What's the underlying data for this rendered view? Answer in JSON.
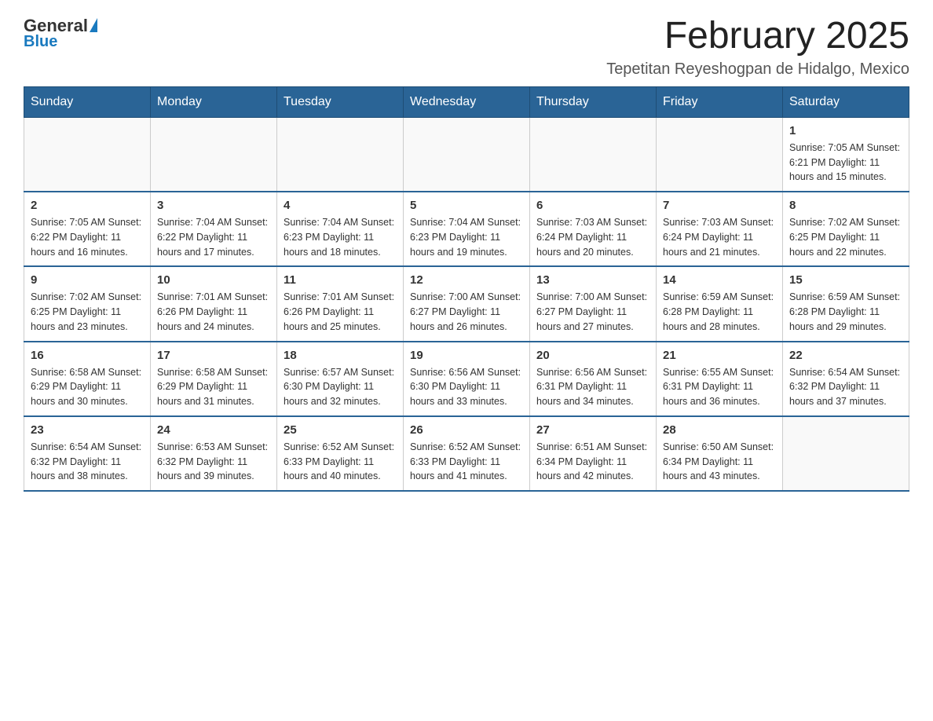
{
  "logo": {
    "general": "General",
    "blue": "Blue"
  },
  "title": "February 2025",
  "location": "Tepetitan Reyeshogpan de Hidalgo, Mexico",
  "weekdays": [
    "Sunday",
    "Monday",
    "Tuesday",
    "Wednesday",
    "Thursday",
    "Friday",
    "Saturday"
  ],
  "weeks": [
    [
      {
        "day": "",
        "info": ""
      },
      {
        "day": "",
        "info": ""
      },
      {
        "day": "",
        "info": ""
      },
      {
        "day": "",
        "info": ""
      },
      {
        "day": "",
        "info": ""
      },
      {
        "day": "",
        "info": ""
      },
      {
        "day": "1",
        "info": "Sunrise: 7:05 AM\nSunset: 6:21 PM\nDaylight: 11 hours and 15 minutes."
      }
    ],
    [
      {
        "day": "2",
        "info": "Sunrise: 7:05 AM\nSunset: 6:22 PM\nDaylight: 11 hours and 16 minutes."
      },
      {
        "day": "3",
        "info": "Sunrise: 7:04 AM\nSunset: 6:22 PM\nDaylight: 11 hours and 17 minutes."
      },
      {
        "day": "4",
        "info": "Sunrise: 7:04 AM\nSunset: 6:23 PM\nDaylight: 11 hours and 18 minutes."
      },
      {
        "day": "5",
        "info": "Sunrise: 7:04 AM\nSunset: 6:23 PM\nDaylight: 11 hours and 19 minutes."
      },
      {
        "day": "6",
        "info": "Sunrise: 7:03 AM\nSunset: 6:24 PM\nDaylight: 11 hours and 20 minutes."
      },
      {
        "day": "7",
        "info": "Sunrise: 7:03 AM\nSunset: 6:24 PM\nDaylight: 11 hours and 21 minutes."
      },
      {
        "day": "8",
        "info": "Sunrise: 7:02 AM\nSunset: 6:25 PM\nDaylight: 11 hours and 22 minutes."
      }
    ],
    [
      {
        "day": "9",
        "info": "Sunrise: 7:02 AM\nSunset: 6:25 PM\nDaylight: 11 hours and 23 minutes."
      },
      {
        "day": "10",
        "info": "Sunrise: 7:01 AM\nSunset: 6:26 PM\nDaylight: 11 hours and 24 minutes."
      },
      {
        "day": "11",
        "info": "Sunrise: 7:01 AM\nSunset: 6:26 PM\nDaylight: 11 hours and 25 minutes."
      },
      {
        "day": "12",
        "info": "Sunrise: 7:00 AM\nSunset: 6:27 PM\nDaylight: 11 hours and 26 minutes."
      },
      {
        "day": "13",
        "info": "Sunrise: 7:00 AM\nSunset: 6:27 PM\nDaylight: 11 hours and 27 minutes."
      },
      {
        "day": "14",
        "info": "Sunrise: 6:59 AM\nSunset: 6:28 PM\nDaylight: 11 hours and 28 minutes."
      },
      {
        "day": "15",
        "info": "Sunrise: 6:59 AM\nSunset: 6:28 PM\nDaylight: 11 hours and 29 minutes."
      }
    ],
    [
      {
        "day": "16",
        "info": "Sunrise: 6:58 AM\nSunset: 6:29 PM\nDaylight: 11 hours and 30 minutes."
      },
      {
        "day": "17",
        "info": "Sunrise: 6:58 AM\nSunset: 6:29 PM\nDaylight: 11 hours and 31 minutes."
      },
      {
        "day": "18",
        "info": "Sunrise: 6:57 AM\nSunset: 6:30 PM\nDaylight: 11 hours and 32 minutes."
      },
      {
        "day": "19",
        "info": "Sunrise: 6:56 AM\nSunset: 6:30 PM\nDaylight: 11 hours and 33 minutes."
      },
      {
        "day": "20",
        "info": "Sunrise: 6:56 AM\nSunset: 6:31 PM\nDaylight: 11 hours and 34 minutes."
      },
      {
        "day": "21",
        "info": "Sunrise: 6:55 AM\nSunset: 6:31 PM\nDaylight: 11 hours and 36 minutes."
      },
      {
        "day": "22",
        "info": "Sunrise: 6:54 AM\nSunset: 6:32 PM\nDaylight: 11 hours and 37 minutes."
      }
    ],
    [
      {
        "day": "23",
        "info": "Sunrise: 6:54 AM\nSunset: 6:32 PM\nDaylight: 11 hours and 38 minutes."
      },
      {
        "day": "24",
        "info": "Sunrise: 6:53 AM\nSunset: 6:32 PM\nDaylight: 11 hours and 39 minutes."
      },
      {
        "day": "25",
        "info": "Sunrise: 6:52 AM\nSunset: 6:33 PM\nDaylight: 11 hours and 40 minutes."
      },
      {
        "day": "26",
        "info": "Sunrise: 6:52 AM\nSunset: 6:33 PM\nDaylight: 11 hours and 41 minutes."
      },
      {
        "day": "27",
        "info": "Sunrise: 6:51 AM\nSunset: 6:34 PM\nDaylight: 11 hours and 42 minutes."
      },
      {
        "day": "28",
        "info": "Sunrise: 6:50 AM\nSunset: 6:34 PM\nDaylight: 11 hours and 43 minutes."
      },
      {
        "day": "",
        "info": ""
      }
    ]
  ]
}
